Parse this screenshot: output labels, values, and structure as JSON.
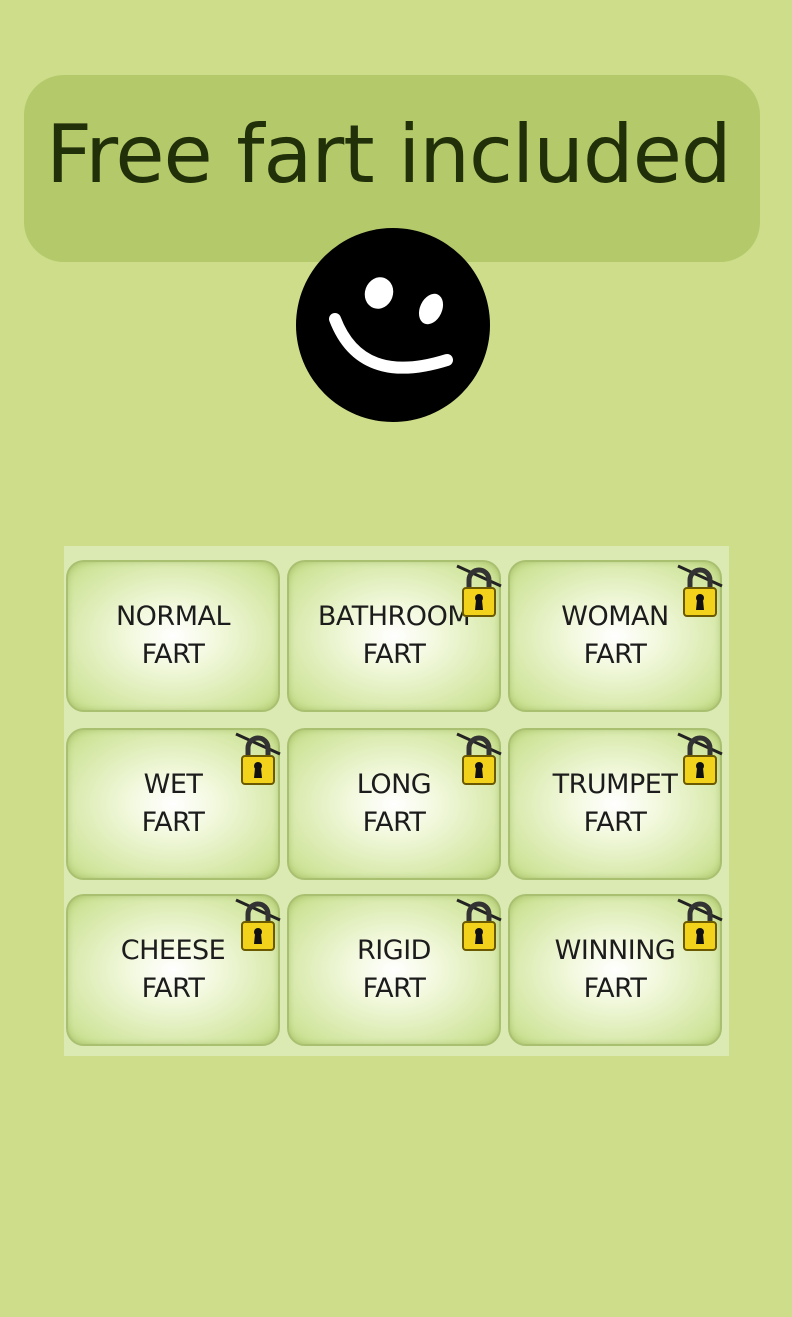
{
  "banner": {
    "title": "Free fart included"
  },
  "icons": {
    "smiley": "smiley-face-icon",
    "lock": "padlock-icon"
  },
  "colors": {
    "background": "#cddd8a",
    "banner": "#b3c96a",
    "title_text": "#22300a",
    "lock_gold": "#f2d21a"
  },
  "tiles": [
    {
      "line1": "NORMAL",
      "line2": "FART",
      "locked": false
    },
    {
      "line1": "BATHROOM",
      "line2": "FART",
      "locked": true
    },
    {
      "line1": "WOMAN",
      "line2": "FART",
      "locked": true
    },
    {
      "line1": "WET",
      "line2": "FART",
      "locked": true
    },
    {
      "line1": "LONG",
      "line2": "FART",
      "locked": true
    },
    {
      "line1": "TRUMPET",
      "line2": "FART",
      "locked": true
    },
    {
      "line1": "CHEESE",
      "line2": "FART",
      "locked": true
    },
    {
      "line1": "RIGID",
      "line2": "FART",
      "locked": true
    },
    {
      "line1": "WINNING",
      "line2": "FART",
      "locked": true
    }
  ]
}
